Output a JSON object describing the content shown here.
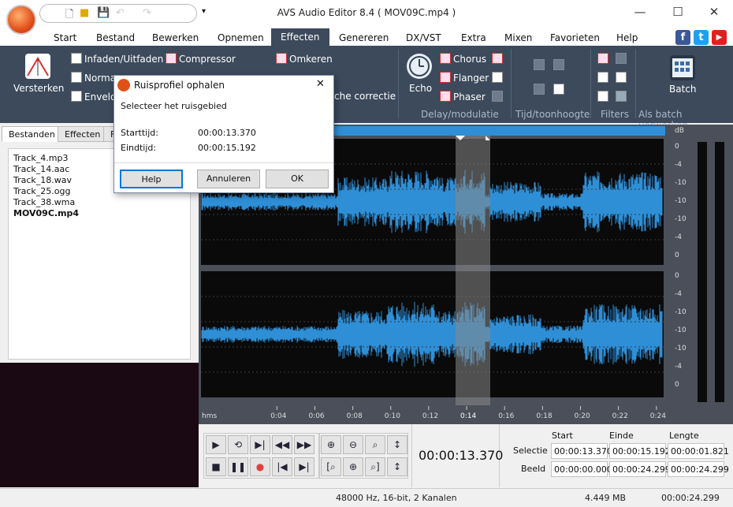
{
  "window": {
    "title": "AVS Audio Editor 8.4  ( MOV09C.mp4 )",
    "minimize": "—",
    "maximize": "☐",
    "close": "✕"
  },
  "qat": {
    "icons": [
      "new-file-icon",
      "open-folder-icon",
      "save-icon",
      "undo-icon",
      "redo-icon",
      "customize-icon"
    ]
  },
  "menu": {
    "items": [
      "Start",
      "Bestand",
      "Bewerken",
      "Opnemen",
      "Effecten",
      "Genereren",
      "DX/VST",
      "Extra",
      "Mixen",
      "Favorieten",
      "Help"
    ],
    "active": "Effecten"
  },
  "social": [
    "f",
    "t",
    "▶"
  ],
  "colors": {
    "ribbon": "#3c4a5c",
    "wave": "#2e8fd6",
    "waveBg": "#0a0a0a",
    "selection": "#8a8a8a",
    "accent": "#0078d7"
  },
  "ribbon": {
    "versterken": "Versterken",
    "fade": "Infaden/Uitfaden",
    "normalize": "Norma",
    "envelope": "Envelo",
    "compressor": "Compressor",
    "reverse": "Omkeren",
    "correction": "che correctie",
    "echo": "Echo",
    "chorus": "Chorus",
    "flanger": "Flanger",
    "phaser": "Phaser",
    "batch": "Batch",
    "group_delay": "Delay/modulatie",
    "group_time": "Tijd/toonhoogte",
    "group_filters": "Filters",
    "group_batch": "Als batch verwerken"
  },
  "leftpanel": {
    "tabs": [
      "Bestanden",
      "Effecten",
      "F"
    ],
    "files": [
      "Track_4.mp3",
      "Track_14.aac",
      "Track_18.wav",
      "Track_25.ogg",
      "Track_38.wma",
      "MOV09C.mp4"
    ],
    "selected": "MOV09C.mp4"
  },
  "timeline": {
    "unit": "hms",
    "ticks": [
      "0:04",
      "0:06",
      "0:08",
      "0:10",
      "0:12",
      "0:14",
      "0:16",
      "0:18",
      "0:20",
      "0:22",
      "0:24"
    ],
    "selected_tick": "0:14",
    "db_label": "dB",
    "db_ticks_top": [
      "0",
      "-4",
      "-10",
      "-10",
      "-10",
      "-4",
      "0"
    ],
    "db_ticks_bottom": [
      "0",
      "-4",
      "-10",
      "-10",
      "-10",
      "-4",
      "0"
    ]
  },
  "transport": {
    "time": "00:00:13.370",
    "start_header": "Start",
    "end_header": "Einde",
    "length_header": "Lengte",
    "selection_label": "Selectie",
    "view_label": "Beeld",
    "sel_start": "00:00:13.370",
    "sel_end": "00:00:15.192",
    "sel_length": "00:00:01.821",
    "view_start": "00:00:00.000",
    "view_end": "00:00:24.299",
    "view_length": "00:00:24.299"
  },
  "status": {
    "format": "48000 Hz, 16-bit, 2 Kanalen",
    "size": "4.449 MB",
    "duration": "00:00:24.299"
  },
  "dialog": {
    "title": "Ruisprofiel ophalen",
    "instruction": "Selecteer het ruisgebied",
    "start_label": "Starttijd:",
    "start_value": "00:00:13.370",
    "end_label": "Eindtijd:",
    "end_value": "00:00:15.192",
    "help": "Help",
    "cancel": "Annuleren",
    "ok": "OK",
    "close": "✕"
  }
}
